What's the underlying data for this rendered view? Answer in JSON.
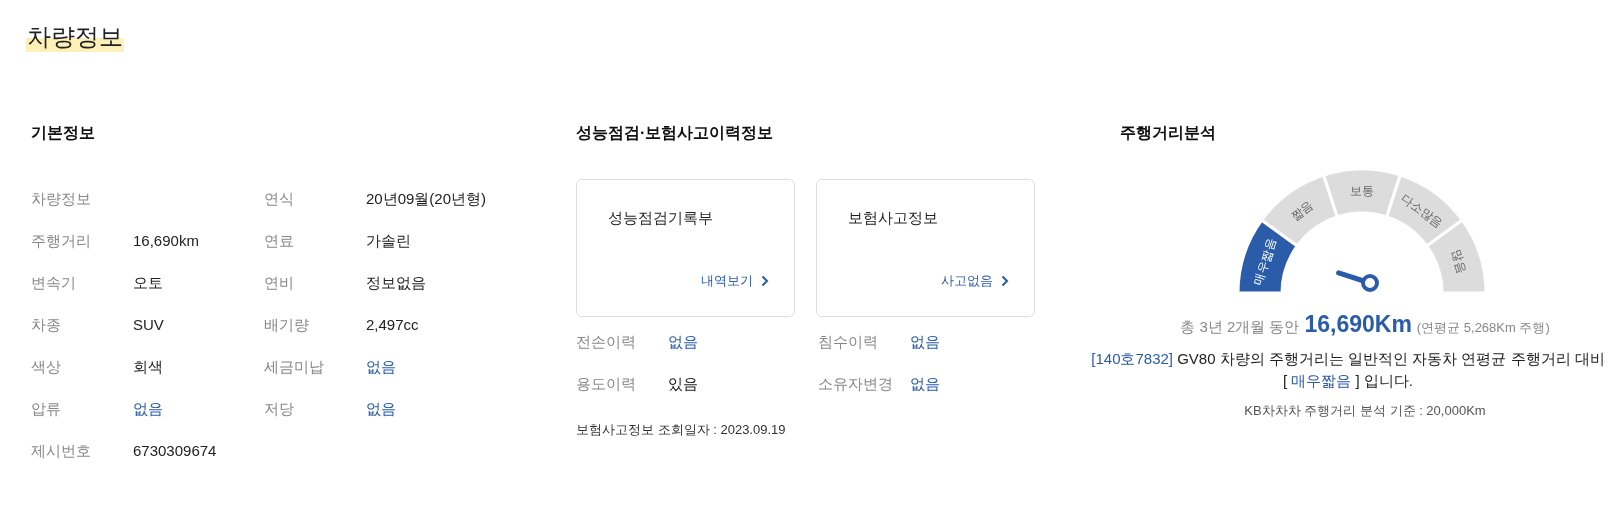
{
  "page_title": "차량정보",
  "basic_info": {
    "heading": "기본정보",
    "rows": [
      [
        {
          "label": "차량정보"
        },
        {
          "label": "연식",
          "value": "20년09월(20년형)",
          "highlight": false
        }
      ],
      [
        {
          "label": "주행거리",
          "value": "16,690km",
          "highlight": false
        },
        {
          "label": "연료",
          "value": "가솔린",
          "highlight": false
        }
      ],
      [
        {
          "label": "변속기",
          "value": "오토",
          "highlight": false
        },
        {
          "label": "연비",
          "value": "정보없음",
          "highlight": false
        }
      ],
      [
        {
          "label": "차종",
          "value": "SUV",
          "highlight": false
        },
        {
          "label": "배기량",
          "value": "2,497cc",
          "highlight": false
        }
      ],
      [
        {
          "label": "색상",
          "value": "회색",
          "highlight": false
        },
        {
          "label": "세금미납",
          "value": "없음",
          "highlight": true
        }
      ],
      [
        {
          "label": "압류",
          "value": "없음",
          "highlight": true
        },
        {
          "label": "저당",
          "value": "없음",
          "highlight": true
        }
      ],
      [
        {
          "label": "제시번호",
          "value": "6730309674",
          "highlight": false
        }
      ]
    ]
  },
  "history": {
    "heading": "성능점검·보험사고이력정보",
    "cards": [
      {
        "title": "성능점검기록부",
        "link": "내역보기"
      },
      {
        "title": "보험사고정보",
        "link": "사고없음"
      }
    ],
    "rows": [
      [
        {
          "label": "전손이력",
          "value": "없음",
          "highlight": true
        },
        {
          "label": "침수이력",
          "value": "없음",
          "highlight": true
        }
      ],
      [
        {
          "label": "용도이력",
          "value": "있음",
          "highlight": false
        },
        {
          "label": "소유자변경",
          "value": "없음",
          "highlight": true
        }
      ]
    ],
    "lookup_date": "보험사고정보 조회일자 : 2023.09.19"
  },
  "mileage": {
    "heading": "주행거리분석",
    "gauge": {
      "segments": [
        {
          "label": "매우짧음",
          "selected": true
        },
        {
          "label": "짧음",
          "selected": false
        },
        {
          "label": "보통",
          "selected": false
        },
        {
          "label": "다소많음",
          "selected": false
        },
        {
          "label": "많음",
          "selected": false
        }
      ]
    },
    "period": "총 3년 2개월 동안",
    "total": "16,690Km",
    "average": "(연평균 5,268Km 주행)",
    "summary": [
      {
        "text": "[140호7832]",
        "highlight": true
      },
      {
        "text": " GV80 차량의 주행거리는 일반적인 자동차 연평균 주행거리 대비 [ ",
        "highlight": false
      },
      {
        "text": "매우짧음",
        "highlight": true
      },
      {
        "text": " ] 입니다.",
        "highlight": false
      }
    ],
    "basis": "KB차차차 주행거리 분석 기준 : 20,000Km"
  }
}
